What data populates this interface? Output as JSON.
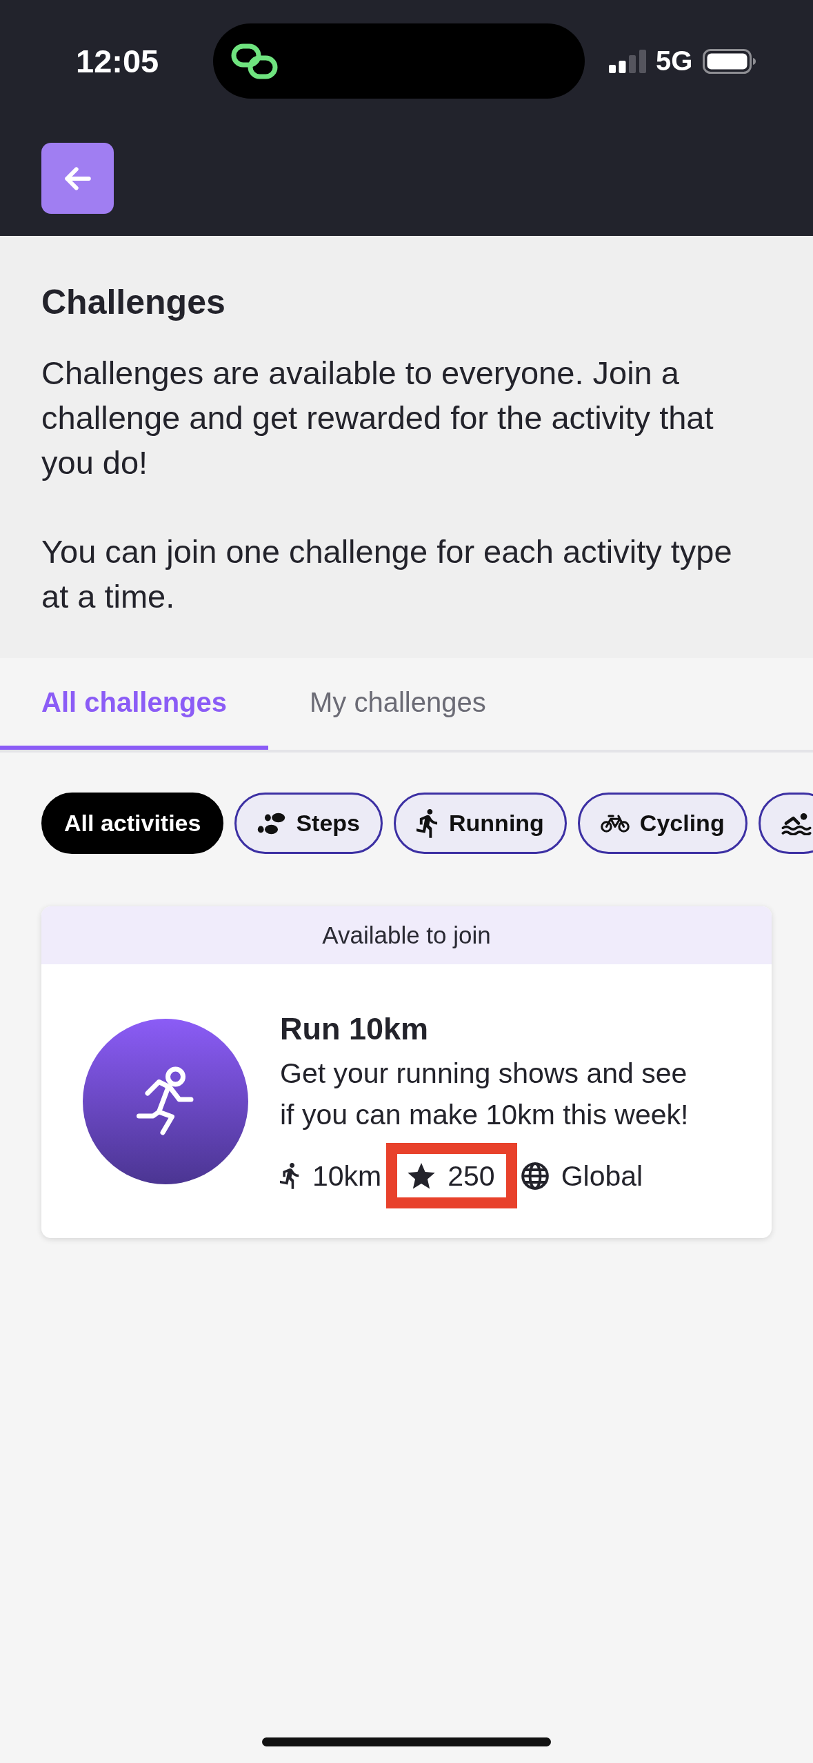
{
  "status_bar": {
    "time": "12:05",
    "network": "5G"
  },
  "intro": {
    "title": "Challenges",
    "paragraphs": [
      "Challenges are available to everyone. Join a challenge and get rewarded for the activity that you do!",
      "You can join one challenge for each activity type at a time."
    ]
  },
  "tabs": [
    {
      "label": "All challenges",
      "selected": true
    },
    {
      "label": "My challenges",
      "selected": false
    }
  ],
  "filters": [
    {
      "label": "All activities",
      "selected": true
    },
    {
      "label": "Steps",
      "selected": false
    },
    {
      "label": "Running",
      "selected": false
    },
    {
      "label": "Cycling",
      "selected": false
    },
    {
      "selected": false
    }
  ],
  "challenges": [
    {
      "status": "Available to join",
      "title": "Run 10km",
      "description": "Get your running shows and see if you can make 10km this week!",
      "stats": [
        {
          "value": "10km",
          "highlighted": false
        },
        {
          "value": "250",
          "highlighted": true
        },
        {
          "value": "Global",
          "highlighted": false
        }
      ]
    }
  ]
}
